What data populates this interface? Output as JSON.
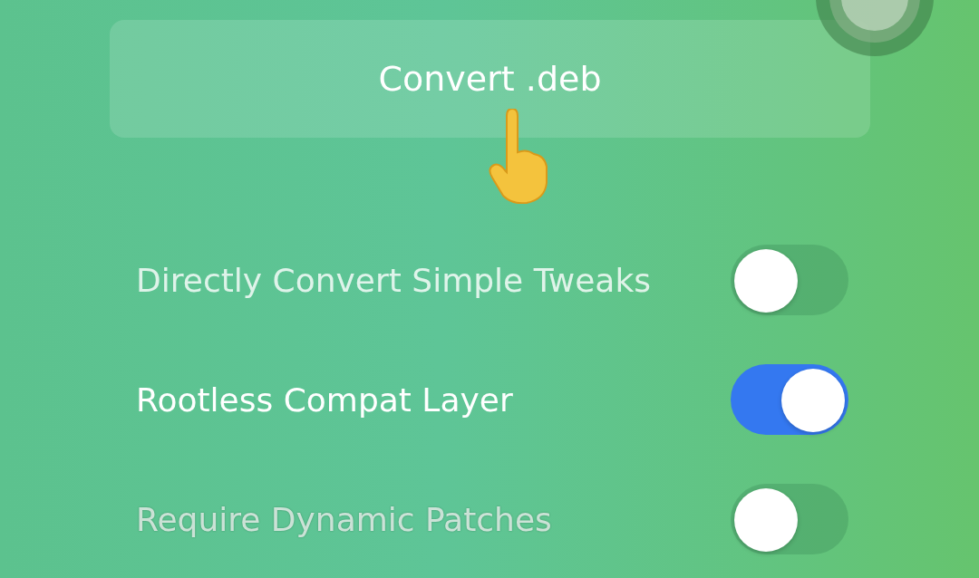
{
  "button": {
    "label": "Convert .deb"
  },
  "settings": [
    {
      "label": "Directly Convert Simple Tweaks",
      "on": false,
      "disabled": false
    },
    {
      "label": "Rootless Compat Layer",
      "on": true,
      "disabled": false
    },
    {
      "label": "Require Dynamic Patches",
      "on": false,
      "disabled": true
    }
  ]
}
